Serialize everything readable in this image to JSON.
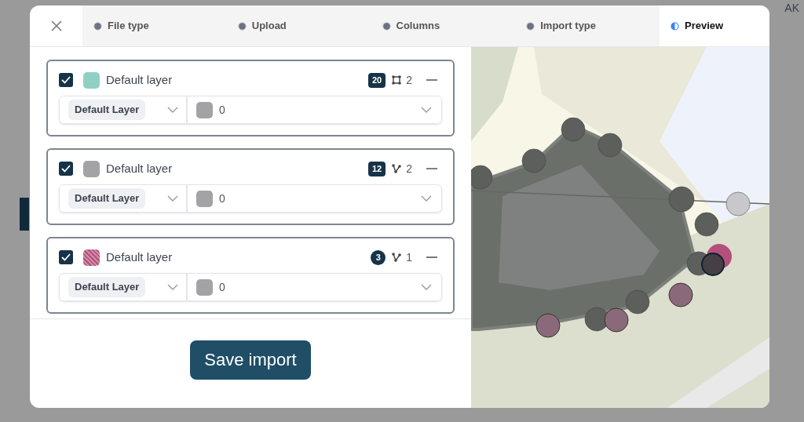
{
  "background": {
    "avatar": "AK"
  },
  "steps": [
    {
      "label": "File type",
      "selected": false
    },
    {
      "label": "Upload",
      "selected": false
    },
    {
      "label": "Columns",
      "selected": false
    },
    {
      "label": "Import type",
      "selected": false
    },
    {
      "label": "Preview",
      "selected": true
    }
  ],
  "layers": [
    {
      "checked": true,
      "color": "#8fd0c5",
      "name": "Default layer",
      "count": "20",
      "kind": "polygon",
      "geometry_count": "2",
      "layer_select": "Default Layer",
      "value_select": "0"
    },
    {
      "checked": true,
      "color": "#a3a3a6",
      "name": "Default layer",
      "count": "12",
      "kind": "line",
      "geometry_count": "2",
      "layer_select": "Default Layer",
      "value_select": "0"
    },
    {
      "checked": true,
      "color": "#b4507c",
      "name": "Default layer",
      "count": "3",
      "kind": "line",
      "geometry_count": "1",
      "layer_select": "Default Layer",
      "value_select": "0"
    }
  ],
  "save_button": "Save import"
}
